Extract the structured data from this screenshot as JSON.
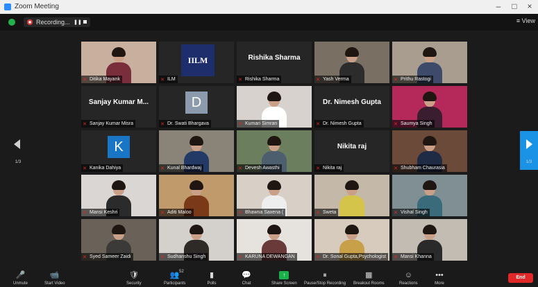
{
  "window": {
    "title": "Zoom Meeting",
    "controls": [
      "–",
      "□",
      "×"
    ]
  },
  "topbar": {
    "recording_label": "Recording...",
    "view_label": "≡ View"
  },
  "grid": {
    "page_indicator": "1/3",
    "tiles": [
      [
        {
          "label": "Ditika Mayank",
          "kind": "photo",
          "bg": "#c9b09e",
          "shirt": "#7a2e3c"
        },
        {
          "label": "ILM",
          "kind": "logo",
          "logo_text": "IILM",
          "bg": "#1e2d6b"
        },
        {
          "label": "Rishika Sharma",
          "kind": "name",
          "display": "Rishika Sharma"
        },
        {
          "label": "Yash Verma",
          "kind": "photo",
          "bg": "#7a6f63",
          "shirt": "#2c2c2c"
        },
        {
          "label": "Prithu Rastogi",
          "kind": "photo",
          "bg": "#a99d90",
          "shirt": "#3e4a6a"
        }
      ],
      [
        {
          "label": "Sanjay Kumar Misra",
          "kind": "name",
          "display": "Sanjay Kumar M..."
        },
        {
          "label": "Dr. Swati Bhargava",
          "kind": "avatar",
          "letter": "D",
          "bg": "#8b9aad"
        },
        {
          "label": "Kumari Simran",
          "kind": "photo",
          "bg": "#d8d2ce",
          "shirt": "#ffffff"
        },
        {
          "label": "Dr. Nimesh Gupta",
          "kind": "name",
          "display": "Dr. Nimesh Gupta"
        },
        {
          "label": "Saumya Singh",
          "kind": "photo",
          "bg": "#b4295a",
          "shirt": "#3a1e30"
        }
      ],
      [
        {
          "label": "Kanika Dahiya",
          "kind": "avatar",
          "letter": "K",
          "bg": "#1976c6"
        },
        {
          "label": "Kunal Bhardwaj",
          "kind": "photo",
          "bg": "#8a8478",
          "shirt": "#233a66",
          "active": true
        },
        {
          "label": "Devesh Awasthi",
          "kind": "photo",
          "bg": "#6b7e5e",
          "shirt": "#4d5e6e"
        },
        {
          "label": "Nikita raj",
          "kind": "name",
          "display": "Nikita raj"
        },
        {
          "label": "Shubham Chaurasia",
          "kind": "photo",
          "bg": "#6b4a3a",
          "shirt": "#1f2a44"
        }
      ],
      [
        {
          "label": "Mansi Keshri",
          "kind": "photo",
          "bg": "#d9d6d3",
          "shirt": "#2b2b2b"
        },
        {
          "label": "Aditi Maloo",
          "kind": "photo",
          "bg": "#c09a6a",
          "shirt": "#7a3a1a"
        },
        {
          "label": "Bhawna Saxena (",
          "kind": "photo",
          "bg": "#d8cfc6",
          "shirt": "#eeeeee"
        },
        {
          "label": "Sweta",
          "kind": "photo",
          "bg": "#c4b8a8",
          "shirt": "#d4c44a"
        },
        {
          "label": "Vishal Singh",
          "kind": "photo",
          "bg": "#7f8f94",
          "shirt": "#3a6b7a"
        }
      ],
      [
        {
          "label": "Syed Sameer Zaidi",
          "kind": "photo",
          "bg": "#6a6258",
          "shirt": "#3b3a38"
        },
        {
          "label": "Sudhanshu Singh",
          "kind": "photo",
          "bg": "#d4d0cc",
          "shirt": "#2e2a28"
        },
        {
          "label": "KARUNA DEWANGAN",
          "kind": "photo",
          "bg": "#e6e2de",
          "shirt": "#6a3a3a"
        },
        {
          "label": "Dr. Sonal Gupta,Psychologist",
          "kind": "photo",
          "bg": "#d6cbbd",
          "shirt": "#c9a04a"
        },
        {
          "label": "Mansi Khanna",
          "kind": "photo",
          "bg": "#c2bcb3",
          "shirt": "#2a2a2a"
        }
      ]
    ]
  },
  "toolbar": {
    "items": [
      {
        "id": "unmute",
        "label": "Unmute",
        "icon": "🎤"
      },
      {
        "id": "video",
        "label": "Start Video",
        "icon": "📹"
      },
      {
        "id": "security",
        "label": "Security",
        "icon": "🛡"
      },
      {
        "id": "participants",
        "label": "Participants",
        "icon": "👥",
        "count": "52"
      },
      {
        "id": "polls",
        "label": "Polls",
        "icon": "▮"
      },
      {
        "id": "chat",
        "label": "Chat",
        "icon": "💬"
      },
      {
        "id": "share",
        "label": "Share Screen",
        "icon": "↑"
      },
      {
        "id": "record",
        "label": "Pause/Stop Recording",
        "icon": "⏸"
      },
      {
        "id": "breakout",
        "label": "Breakout Rooms",
        "icon": "▦"
      },
      {
        "id": "reactions",
        "label": "Reactions",
        "icon": "☺"
      },
      {
        "id": "more",
        "label": "More",
        "icon": "•••"
      }
    ],
    "end_label": "End"
  },
  "colors": {
    "active_speaker": "#c6d600",
    "nav_accent": "#1a93e6",
    "end": "#e02828",
    "muted": "#e02828"
  }
}
